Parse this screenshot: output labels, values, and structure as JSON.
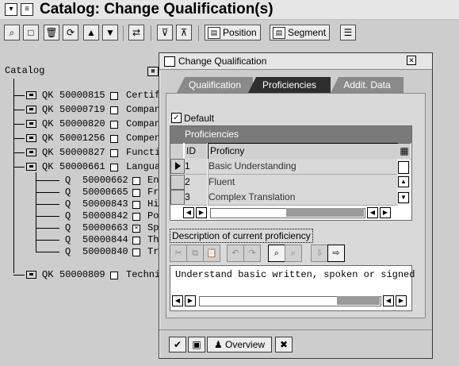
{
  "window": {
    "title": "Catalog: Change Qualification(s)"
  },
  "toolbar": {
    "position_label": "Position",
    "segment_label": "Segment"
  },
  "tree": {
    "catalog_label": "Catalog",
    "groups": [
      {
        "code": "QK",
        "id": "50000815",
        "text": "Certif"
      },
      {
        "code": "QK",
        "id": "50000719",
        "text": "Compan"
      },
      {
        "code": "QK",
        "id": "50000820",
        "text": "Compan"
      },
      {
        "code": "QK",
        "id": "50001256",
        "text": "Compen"
      },
      {
        "code": "QK",
        "id": "50000827",
        "text": "Functi"
      },
      {
        "code": "QK",
        "id": "50000661",
        "text": "Langua"
      }
    ],
    "children": [
      {
        "code": "Q",
        "id": "50000662",
        "text": "En",
        "checked": false
      },
      {
        "code": "Q",
        "id": "50000665",
        "text": "Fr",
        "checked": false
      },
      {
        "code": "Q",
        "id": "50000843",
        "text": "Hi",
        "checked": false
      },
      {
        "code": "Q",
        "id": "50000842",
        "text": "Po",
        "checked": false
      },
      {
        "code": "Q",
        "id": "50000663",
        "text": "Sp",
        "checked": true
      },
      {
        "code": "Q",
        "id": "50000844",
        "text": "Th",
        "checked": false
      },
      {
        "code": "Q",
        "id": "50000840",
        "text": "Tr",
        "checked": false
      }
    ],
    "last_group": {
      "code": "QK",
      "id": "50000809",
      "text": "Techni"
    }
  },
  "dialog": {
    "title": "Change Qualification",
    "tabs": [
      "Qualification",
      "Proficiencies",
      "Addit. Data"
    ],
    "default_label": "Default",
    "table_title": "Proficiencies",
    "col_id": "ID",
    "col_prof": "Proficny",
    "rows": [
      {
        "id": "1",
        "label": "Basic Understanding"
      },
      {
        "id": "2",
        "label": "Fluent"
      },
      {
        "id": "3",
        "label": "Complex Translation"
      }
    ],
    "desc_label": "Description of current proficiency",
    "desc_text": "Understand basic written, spoken or signed",
    "overview_label": "Overview"
  },
  "colors": {
    "background": "#cdcdcd",
    "tab_active": "#2e2e2e",
    "tab_inactive": "#8a8a8a"
  }
}
